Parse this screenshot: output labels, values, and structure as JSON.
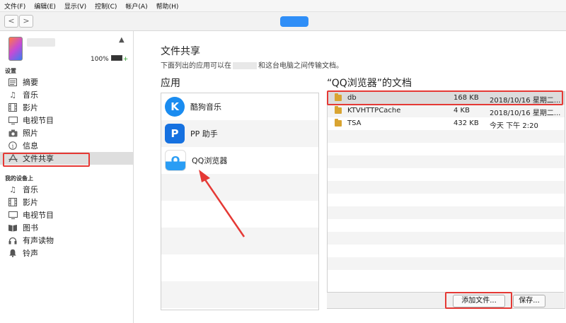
{
  "menu": [
    "文件(F)",
    "编辑(E)",
    "显示(V)",
    "控制(C)",
    "帐户(A)",
    "帮助(H)"
  ],
  "nav": {
    "back": "<",
    "forward": ">"
  },
  "device": {
    "battery": "100%",
    "charging": "+"
  },
  "sidebar": {
    "settings_header": "设置",
    "settings_items": [
      {
        "label": "摘要",
        "icon": "summary-icon"
      },
      {
        "label": "音乐",
        "icon": "music-note-icon"
      },
      {
        "label": "影片",
        "icon": "film-icon"
      },
      {
        "label": "电视节目",
        "icon": "tv-icon"
      },
      {
        "label": "照片",
        "icon": "camera-icon"
      },
      {
        "label": "信息",
        "icon": "info-icon"
      },
      {
        "label": "文件共享",
        "icon": "app-store-icon"
      }
    ],
    "mydevice_header": "我的设备上",
    "device_items": [
      {
        "label": "音乐",
        "icon": "music-note-icon"
      },
      {
        "label": "影片",
        "icon": "film-icon"
      },
      {
        "label": "电视节目",
        "icon": "tv-icon"
      },
      {
        "label": "图书",
        "icon": "book-icon"
      },
      {
        "label": "有声读物",
        "icon": "audiobook-icon"
      },
      {
        "label": "铃声",
        "icon": "bell-icon"
      }
    ]
  },
  "main": {
    "title": "文件共享",
    "desc_before": "下面列出的应用可以在",
    "desc_after": "和这台电脑之间传输文档。",
    "apps_title": "应用",
    "apps": [
      {
        "label": "酷狗音乐",
        "icon_text": "K",
        "color": "#1a8cf0"
      },
      {
        "label": "PP 助手",
        "icon_text": "P",
        "color": "#1671e0"
      },
      {
        "label": "QQ浏览器",
        "icon_text": "Q",
        "color": "#2a9df4"
      }
    ],
    "docs_title": "“QQ浏览器”的文档",
    "docs": [
      {
        "name": "db",
        "size": "168 KB",
        "date": "2018/10/16 星期二..."
      },
      {
        "name": "KTVHTTPCache",
        "size": "4 KB",
        "date": "2018/10/16 星期二..."
      },
      {
        "name": "TSA",
        "size": "432 KB",
        "date": "今天 下午 2:20"
      }
    ],
    "add_file_label": "添加文件...",
    "save_label": "保存..."
  },
  "colors": {
    "highlight": "#e53935",
    "accent": "#2f8ef7"
  }
}
